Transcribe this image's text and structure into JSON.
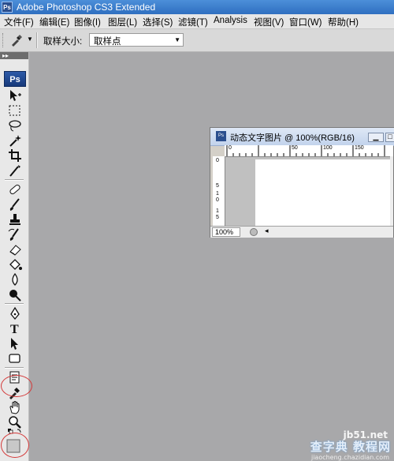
{
  "app": {
    "title": "Adobe Photoshop CS3 Extended",
    "logo": "Ps"
  },
  "menu": [
    "文件(F)",
    "编辑(E)",
    "图像(I)",
    "图层(L)",
    "选择(S)",
    "滤镜(T)",
    "Analysis",
    "视图(V)",
    "窗口(W)",
    "帮助(H)"
  ],
  "options": {
    "sample_size_label": "取样大小:",
    "sample_size_value": "取样点"
  },
  "toolbox": {
    "logo": "Ps"
  },
  "document": {
    "title": "动态文字图片 @ 100%(RGB/16)",
    "zoom": "100%",
    "ruler_h": [
      "0",
      "50",
      "100",
      "150"
    ],
    "ruler_v": [
      "0",
      "5",
      "1",
      "0",
      "1",
      "5"
    ]
  },
  "watermark": {
    "site": "jb51.net",
    "name": "查字典 教程网",
    "sub": "jiaocheng.chazidian.com"
  },
  "colors": {
    "desktop": "#a8a8aa",
    "highlight_circle": "#d43a3a"
  }
}
